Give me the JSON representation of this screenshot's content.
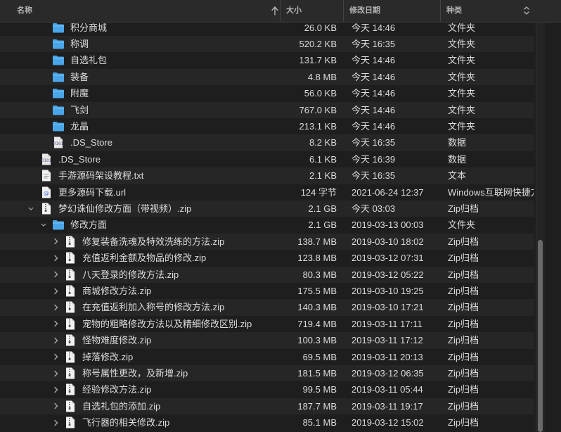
{
  "header": {
    "name": "名称",
    "size": "大小",
    "modified": "修改日期",
    "kind": "种类"
  },
  "rows": [
    {
      "name": "积分商城",
      "size": "26.0 KB",
      "date": "今天 14:46",
      "kind": "文件夹",
      "icon": "folder-icon",
      "depth": 2,
      "chevron": "right"
    },
    {
      "name": "称调",
      "size": "520.2 KB",
      "date": "今天 16:35",
      "kind": "文件夹",
      "icon": "folder-icon",
      "depth": 2,
      "chevron": "right"
    },
    {
      "name": "自选礼包",
      "size": "131.7 KB",
      "date": "今天 14:46",
      "kind": "文件夹",
      "icon": "folder-icon",
      "depth": 2,
      "chevron": "right"
    },
    {
      "name": "装备",
      "size": "4.8 MB",
      "date": "今天 14:46",
      "kind": "文件夹",
      "icon": "folder-icon",
      "depth": 2,
      "chevron": "right"
    },
    {
      "name": "附魔",
      "size": "56.0 KB",
      "date": "今天 14:46",
      "kind": "文件夹",
      "icon": "folder-icon",
      "depth": 2,
      "chevron": "right"
    },
    {
      "name": "飞剑",
      "size": "767.0 KB",
      "date": "今天 14:46",
      "kind": "文件夹",
      "icon": "folder-icon",
      "depth": 2,
      "chevron": "right"
    },
    {
      "name": "龙晶",
      "size": "213.1 KB",
      "date": "今天 14:46",
      "kind": "文件夹",
      "icon": "folder-icon",
      "depth": 2,
      "chevron": "right"
    },
    {
      "name": ".DS_Store",
      "size": "8.2 KB",
      "date": "今天 16:35",
      "kind": "数据",
      "icon": "data-file-icon",
      "depth": 2,
      "chevron": "none"
    },
    {
      "name": ".DS_Store",
      "size": "6.1 KB",
      "date": "今天 16:39",
      "kind": "数据",
      "icon": "data-file-icon",
      "depth": 1,
      "chevron": "none"
    },
    {
      "name": "手游源码架设教程.txt",
      "size": "2.1 KB",
      "date": "今天 16:35",
      "kind": "文本",
      "icon": "document-icon",
      "depth": 1,
      "chevron": "none"
    },
    {
      "name": "更多源码下载.url",
      "size": "124 字节",
      "date": "2021-06-24 12:37",
      "kind": "Windows互联网快捷方式",
      "icon": "url-file-icon",
      "depth": 1,
      "chevron": "none"
    },
    {
      "name": "梦幻诛仙修改方面（带视频）.zip",
      "size": "2.1 GB",
      "date": "今天 03:03",
      "kind": "Zip归档",
      "icon": "zip-file-icon",
      "depth": 0,
      "chevron": "down"
    },
    {
      "name": "修改方面",
      "size": "2.1 GB",
      "date": "2019-03-13 00:03",
      "kind": "文件夹",
      "icon": "folder-icon",
      "depth": 1,
      "chevron": "down"
    },
    {
      "name": "修复装备洗魂及特效洗练的方法.zip",
      "size": "138.7 MB",
      "date": "2019-03-10 18:02",
      "kind": "Zip归档",
      "icon": "zip-file-icon",
      "depth": 2,
      "chevron": "right"
    },
    {
      "name": "充值返利金额及物品的修改.zip",
      "size": "123.8 MB",
      "date": "2019-03-12 07:31",
      "kind": "Zip归档",
      "icon": "zip-file-icon",
      "depth": 2,
      "chevron": "right"
    },
    {
      "name": "八天登录的修改方法.zip",
      "size": "80.3 MB",
      "date": "2019-03-12 05:22",
      "kind": "Zip归档",
      "icon": "zip-file-icon",
      "depth": 2,
      "chevron": "right"
    },
    {
      "name": "商城修改方法.zip",
      "size": "175.5 MB",
      "date": "2019-03-10 19:25",
      "kind": "Zip归档",
      "icon": "zip-file-icon",
      "depth": 2,
      "chevron": "right"
    },
    {
      "name": "在充值返利加入称号的修改方法.zip",
      "size": "140.3 MB",
      "date": "2019-03-10 17:21",
      "kind": "Zip归档",
      "icon": "zip-file-icon",
      "depth": 2,
      "chevron": "right"
    },
    {
      "name": "宠物的粗略修改方法以及精细修改区别.zip",
      "size": "719.4 MB",
      "date": "2019-03-11 17:11",
      "kind": "Zip归档",
      "icon": "zip-file-icon",
      "depth": 2,
      "chevron": "right"
    },
    {
      "name": "怪物难度修改.zip",
      "size": "100.3 MB",
      "date": "2019-03-11 17:12",
      "kind": "Zip归档",
      "icon": "zip-file-icon",
      "depth": 2,
      "chevron": "right"
    },
    {
      "name": "掉落修改.zip",
      "size": "69.5 MB",
      "date": "2019-03-11 20:13",
      "kind": "Zip归档",
      "icon": "zip-file-icon",
      "depth": 2,
      "chevron": "right"
    },
    {
      "name": "称号属性更改，及新增.zip",
      "size": "181.5 MB",
      "date": "2019-03-12 06:35",
      "kind": "Zip归档",
      "icon": "zip-file-icon",
      "depth": 2,
      "chevron": "right"
    },
    {
      "name": "经验修改方法.zip",
      "size": "99.5 MB",
      "date": "2019-03-11 05:44",
      "kind": "Zip归档",
      "icon": "zip-file-icon",
      "depth": 2,
      "chevron": "right"
    },
    {
      "name": "自选礼包的添加.zip",
      "size": "187.7 MB",
      "date": "2019-03-11 19:17",
      "kind": "Zip归档",
      "icon": "zip-file-icon",
      "depth": 2,
      "chevron": "right"
    },
    {
      "name": "飞行器的相关修改.zip",
      "size": "85.1 MB",
      "date": "2019-03-12 15:02",
      "kind": "Zip归档",
      "icon": "zip-file-icon",
      "depth": 2,
      "chevron": "right"
    }
  ],
  "colors": {
    "background": "#1e1e1e",
    "row_alt": "#262626",
    "folder": "#4aa6e8",
    "text": "#dcdcdc",
    "muted": "#b4b4b4"
  }
}
